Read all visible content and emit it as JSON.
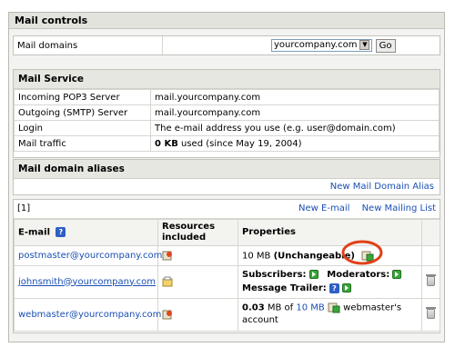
{
  "title": "Mail controls",
  "domains": {
    "label": "Mail domains",
    "selected": "yourcompany.com",
    "go": "Go"
  },
  "service": {
    "heading": "Mail Service",
    "rows": [
      {
        "k": "Incoming POP3 Server",
        "v": "mail.yourcompany.com"
      },
      {
        "k": "Outgoing (SMTP) Server",
        "v": "mail.yourcompany.com"
      },
      {
        "k": "Login",
        "v": "The e-mail address you use (e.g. user@domain.com)"
      }
    ],
    "traffic": {
      "k": "Mail traffic",
      "amount": "0 KB",
      "rest": " used (since May 19, 2004)"
    }
  },
  "aliases": {
    "heading": "Mail domain aliases",
    "new_alias": "New Mail Domain Alias"
  },
  "accounts": {
    "page": "[1]",
    "new_email": "New E-mail",
    "new_list": "New Mailing List",
    "headers": {
      "email": "E-mail",
      "resources": "Resources included",
      "properties": "Properties"
    },
    "rows": [
      {
        "email": "postmaster@yourcompany.com",
        "size": "10 MB",
        "state": "(Unchangeable)"
      },
      {
        "email": "johnsmith@yourcompany.com",
        "subscribers": "Subscribers:",
        "moderators": "Moderators:",
        "trailer": "Message Trailer:"
      },
      {
        "email": "webmaster@yourcompany.com",
        "used": "0.03",
        "of": "MB of",
        "quota": "10 MB",
        "note": "webmaster's account"
      }
    ]
  },
  "colors": {
    "link": "#1a4fb3",
    "highlight": "#e0401a",
    "panel": "#f3f3f1"
  },
  "icons": [
    "help-icon",
    "trash-icon",
    "edit-icon",
    "add-green-icon",
    "resource-icon",
    "forward-icon"
  ]
}
